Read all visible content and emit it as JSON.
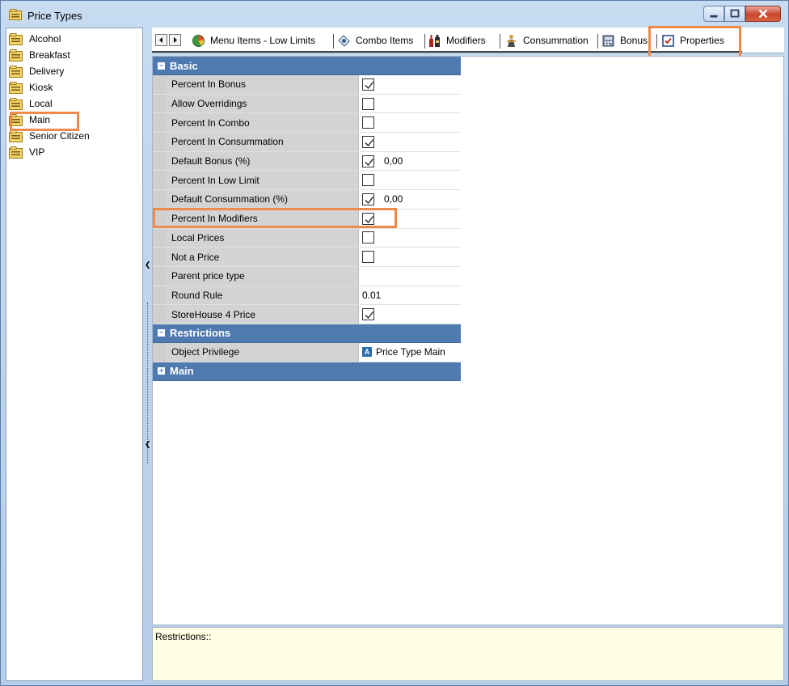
{
  "window": {
    "title": "Price Types"
  },
  "price_types": [
    {
      "label": "Alcohol"
    },
    {
      "label": "Breakfast"
    },
    {
      "label": "Delivery"
    },
    {
      "label": "Kiosk"
    },
    {
      "label": "Local"
    },
    {
      "label": "Main",
      "selected": true
    },
    {
      "label": "Senior Citizen"
    },
    {
      "label": "VIP"
    }
  ],
  "tabs": [
    {
      "label": "Menu Items - Low Limits",
      "icon": "chart-icon"
    },
    {
      "label": "Combo Items",
      "icon": "combo-icon"
    },
    {
      "label": "Modifiers",
      "icon": "bottles-icon"
    },
    {
      "label": "Consummation",
      "icon": "person-icon"
    },
    {
      "label": "Bonus",
      "icon": "calculator-icon"
    },
    {
      "label": "Properties",
      "icon": "properties-icon",
      "active": true
    }
  ],
  "grid": {
    "basic_label": "Basic",
    "restrictions_label": "Restrictions",
    "main_label": "Main",
    "basic_rows": [
      {
        "name": "Percent In Bonus",
        "checked": true,
        "value": ""
      },
      {
        "name": "Allow Overridings",
        "checked": false,
        "value": ""
      },
      {
        "name": "Percent In Combo",
        "checked": false,
        "value": ""
      },
      {
        "name": "Percent In Consummation",
        "checked": true,
        "value": ""
      },
      {
        "name": "Default Bonus (%)",
        "checked": true,
        "value": "0,00"
      },
      {
        "name": "Percent In Low Limit",
        "checked": false,
        "value": ""
      },
      {
        "name": "Default Consummation (%)",
        "checked": true,
        "value": "0,00"
      },
      {
        "name": "Percent In Modifiers",
        "checked": true,
        "value": ""
      },
      {
        "name": "Local Prices",
        "checked": false,
        "value": ""
      },
      {
        "name": "Not a Price",
        "checked": false,
        "value": ""
      },
      {
        "name": "Parent price type",
        "checked": null,
        "value": ""
      },
      {
        "name": "Round Rule",
        "checked": null,
        "value": "0.01"
      },
      {
        "name": "StoreHouse 4 Price",
        "checked": true,
        "value": ""
      }
    ],
    "restriction_rows": [
      {
        "name": "Object Privilege",
        "value": "Price Type Main",
        "icon_letter": "A"
      }
    ]
  },
  "description": {
    "text": "Restrictions::"
  },
  "colors": {
    "category_header": "#4f7ab0",
    "highlight": "#f08a4b",
    "description_bg": "#ffffe3"
  }
}
